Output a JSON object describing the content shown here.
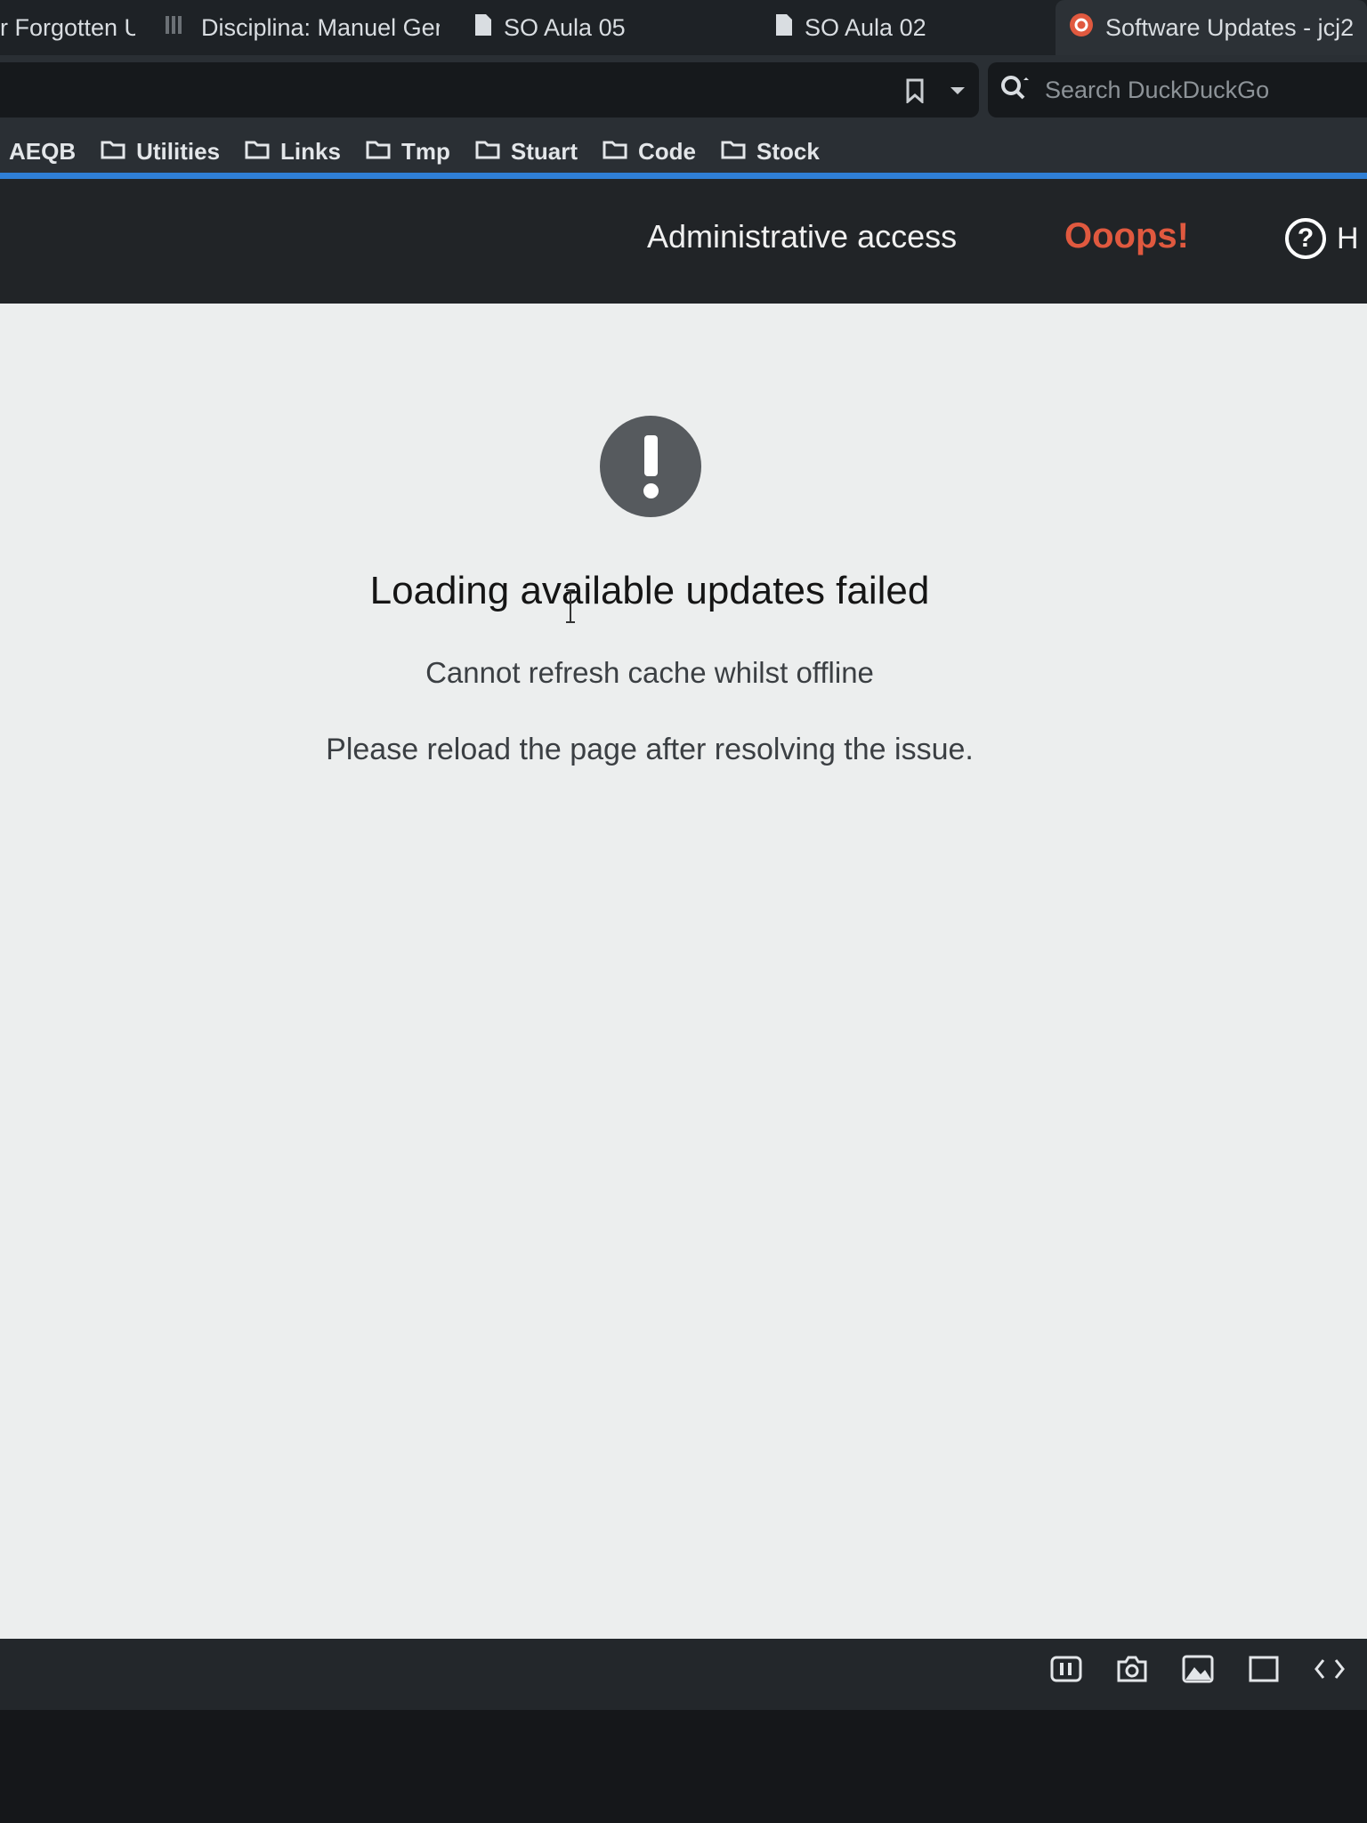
{
  "tabs": [
    {
      "label": "r Forgotten U",
      "active": false
    },
    {
      "label": "Disciplina: Manuel Ger",
      "active": false
    },
    {
      "label": "SO Aula 05",
      "active": false
    },
    {
      "label": "SO Aula 02",
      "active": false
    },
    {
      "label": "Software Updates - jcj2",
      "active": true
    }
  ],
  "search": {
    "placeholder": "Search DuckDuckGo",
    "icon": "search-icon"
  },
  "bookmarks": [
    "AEQB",
    "Utilities",
    "Links",
    "Tmp",
    "Stuart",
    "Code",
    "Stock"
  ],
  "header": {
    "admin_access": "Administrative access",
    "ooops": "Ooops!",
    "help": "H",
    "accent_color": "#e0593f"
  },
  "content": {
    "title": "Loading available updates failed",
    "subtitle": "Cannot refresh cache whilst offline",
    "body": "Please reload the page after resolving the issue."
  },
  "colors": {
    "progress": "#2f7fd6",
    "alert_circle": "#565a5e"
  },
  "bottom_icons": [
    "pause-icon",
    "camera-icon",
    "image-icon",
    "window-icon",
    "code-icon"
  ]
}
